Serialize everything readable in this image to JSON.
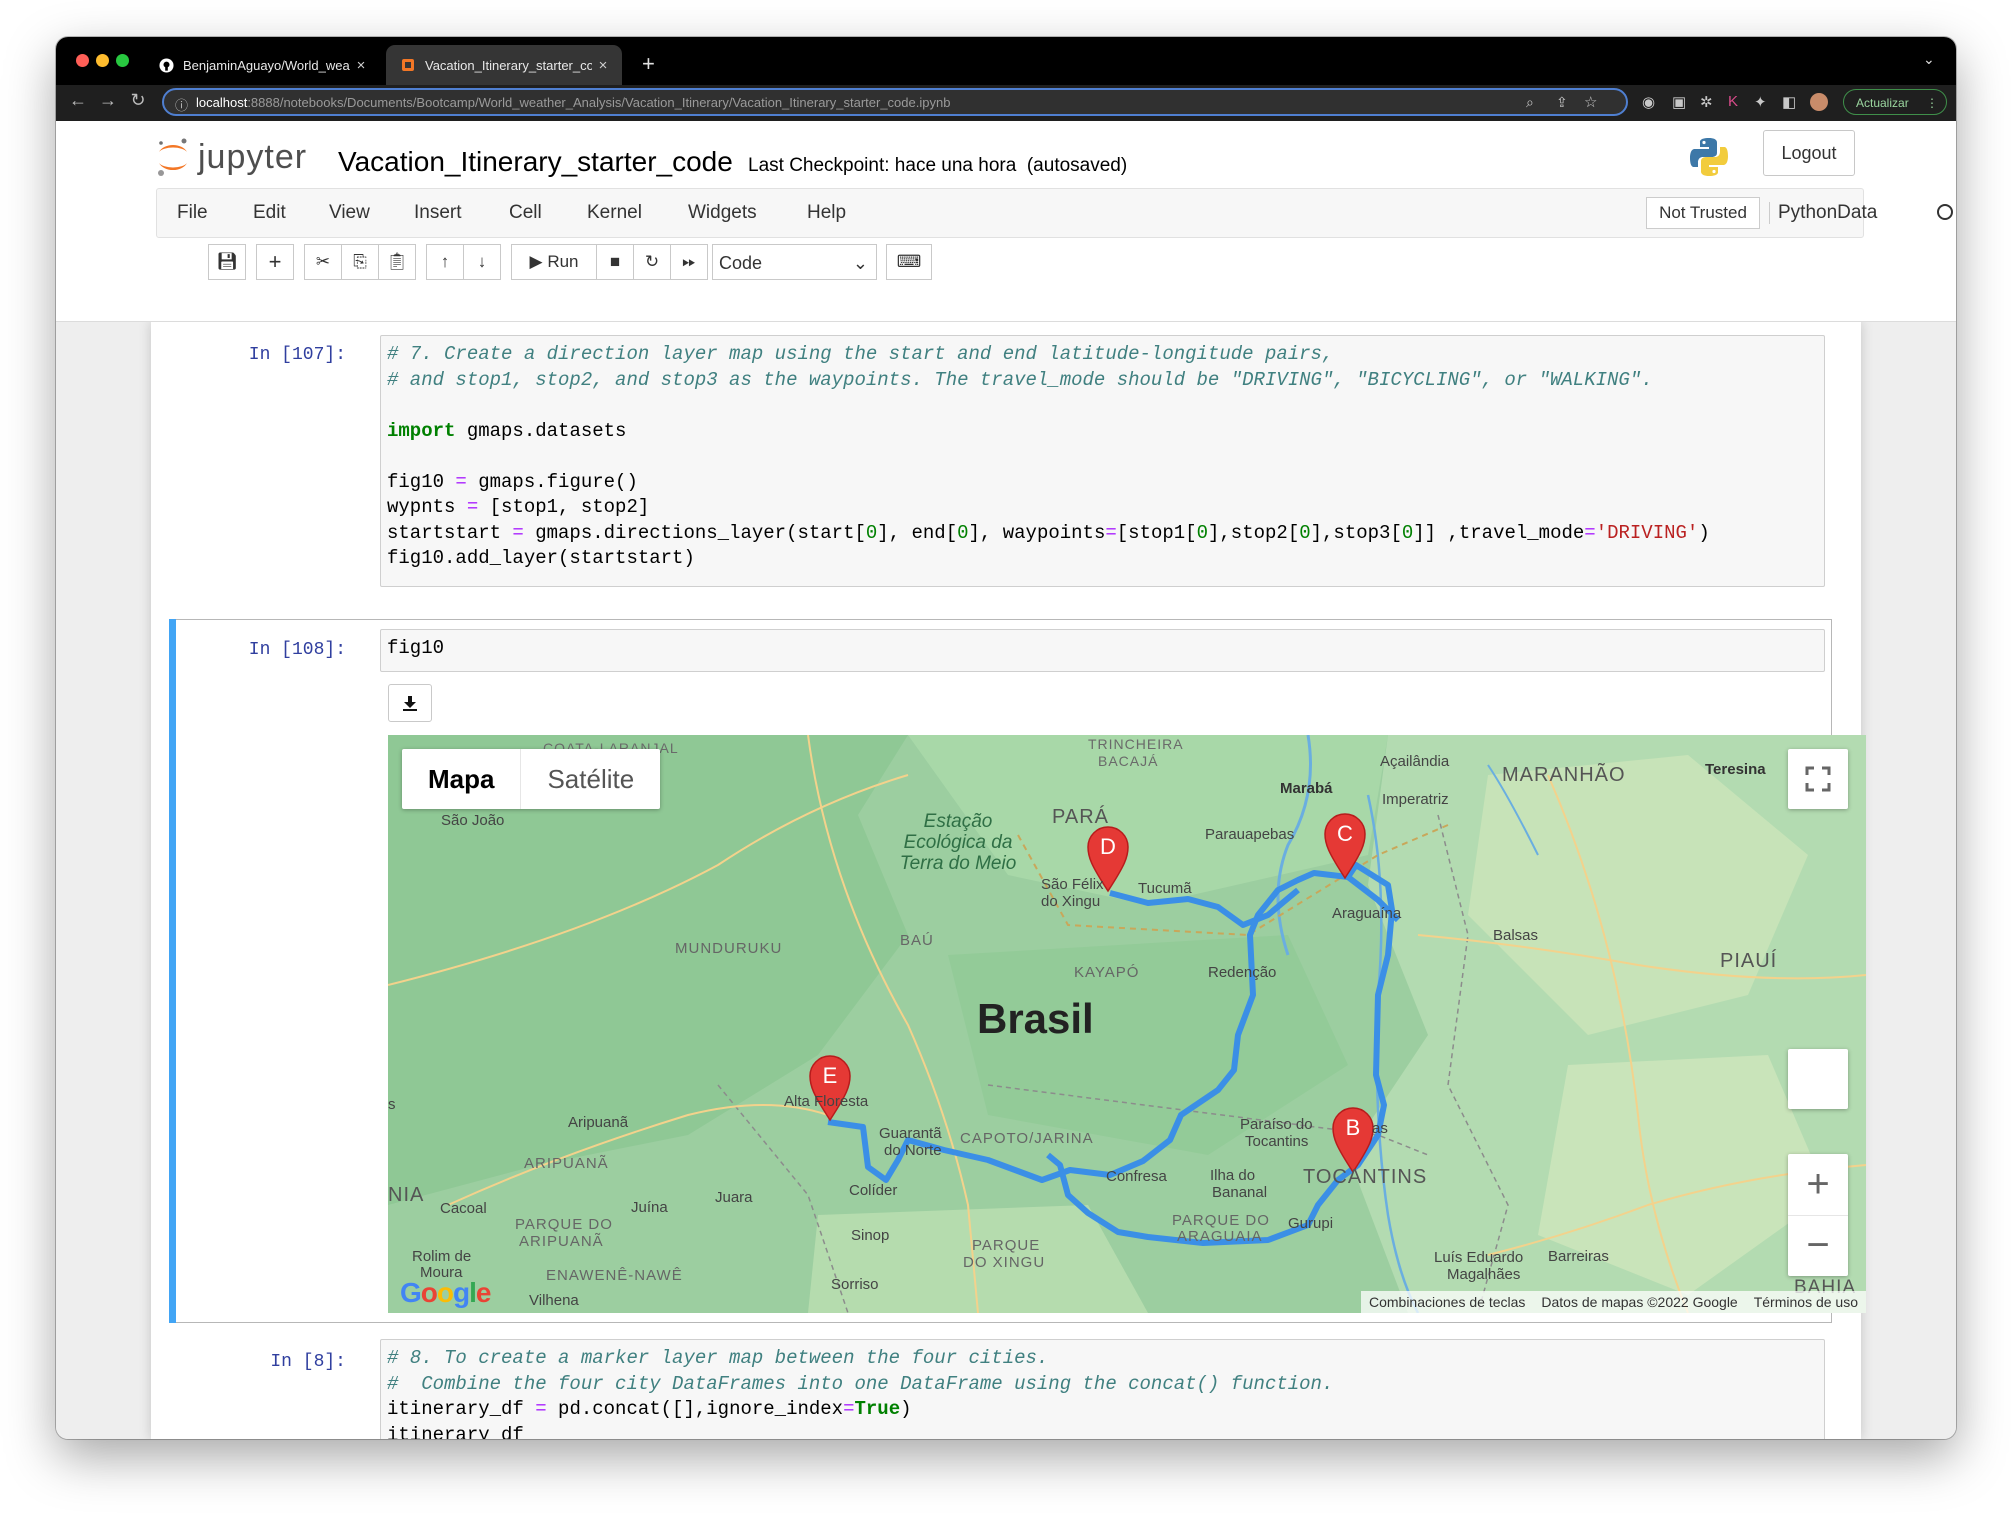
{
  "browser": {
    "tabs": [
      {
        "title": "BenjaminAguayo/World_weath",
        "active": false,
        "icon": "github-icon"
      },
      {
        "title": "Vacation_Itinerary_starter_cod",
        "active": true,
        "icon": "jupyter-favicon-icon"
      }
    ],
    "new_tab": "+",
    "url_host": "localhost",
    "url_path": ":8888/notebooks/Documents/Bootcamp/World_weather_Analysis/Vacation_Itinerary/Vacation_Itinerary_starter_code.ipynb",
    "update_label": "Actualizar"
  },
  "jupyter": {
    "logo_text": "jupyter",
    "notebook_name": "Vacation_Itinerary_starter_code",
    "checkpoint": "Last Checkpoint: hace una hora",
    "autosaved": "(autosaved)",
    "logout": "Logout",
    "menu": [
      "File",
      "Edit",
      "View",
      "Insert",
      "Cell",
      "Kernel",
      "Widgets",
      "Help"
    ],
    "not_trusted": "Not Trusted",
    "kernel": "PythonData",
    "run_label": "Run",
    "cell_type": "Code"
  },
  "cells": [
    {
      "prompt": "In [107]:",
      "lines": [
        "# 7. Create a direction layer map using the start and end latitude-longitude pairs,",
        "# and stop1, stop2, and stop3 as the waypoints. The travel_mode should be \"DRIVING\", \"BICYCLING\", or \"WALKING\".",
        "",
        "import gmaps.datasets",
        "",
        "fig10 = gmaps.figure()",
        "wypnts = [stop1, stop2]",
        "startstart = gmaps.directions_layer(start[0], end[0], waypoints=[stop1[0],stop2[0],stop3[0]] ,travel_mode='DRIVING')",
        "fig10.add_layer(startstart)"
      ]
    },
    {
      "prompt": "In [108]:",
      "lines": [
        "fig10"
      ]
    },
    {
      "prompt": "In [8]:",
      "lines": [
        "# 8. To create a marker layer map between the four cities.",
        "#  Combine the four city DataFrames into one DataFrame using the concat() function.",
        "itinerary_df = pd.concat([],ignore_index=True)",
        "itinerary_df"
      ]
    }
  ],
  "map": {
    "type_buttons": [
      "Mapa",
      "Satélite"
    ],
    "country_label": "Brasil",
    "markers": [
      "D",
      "C",
      "E",
      "B"
    ],
    "places": [
      "COATA-LARANJAL",
      "TRINCHEIRA",
      "BACAJÁ",
      "São João",
      "Estação",
      "Ecológica da",
      "Terra do Meio",
      "PARÁ",
      "Marabá",
      "Açailândia",
      "Imperatriz",
      "MARANHÃO",
      "Teresina",
      "Parauapebas",
      "São Félix",
      "do Xingu",
      "Tucumã",
      "Araguaína",
      "Balsas",
      "PIAUÍ",
      "MUNDURUKU",
      "BAÚ",
      "KAYAPÓ",
      "Redenção",
      "Alta Floresta",
      "Aripuanã",
      "Guarantã",
      "do Norte",
      "CAPOTO/JARINA",
      "Paraíso do",
      "Tocantins",
      "TOCANTINS",
      "ARIPUANÃ",
      "Colíder",
      "Confresa",
      "Ilha do",
      "Bananal",
      "NIA",
      "Cacoal",
      "Juína",
      "Juara",
      "PARQUE DO",
      "ARIPUANÃ",
      "Sinop",
      "PARQUE",
      "DO XINGU",
      "PARQUE DO",
      "ARAGUAIA",
      "Gurupi",
      "Rolim de",
      "Moura",
      "ENAWENÊ-NAWÊ",
      "Luís Eduardo",
      "Magalhães",
      "Barreiras",
      "Sorriso",
      "Vilhena",
      "BAHIA",
      "s",
      "as"
    ],
    "attribution": [
      "Combinaciones de teclas",
      "Datos de mapas ©2022 Google",
      "Términos de uso"
    ],
    "google": "Google",
    "zoom_in": "+",
    "zoom_out": "−",
    "colors": {
      "route": "#3b8fe6",
      "marker": "#e53935",
      "land": "#9ccea0"
    }
  }
}
